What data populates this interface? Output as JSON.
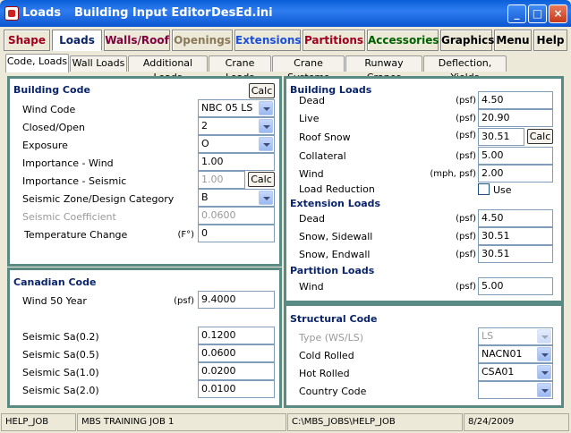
{
  "window": {
    "title_app": "Loads",
    "title_editor": "Building Input Editor",
    "title_file": "DesEd.ini"
  },
  "menu": [
    {
      "label": "Shape",
      "color": "#a0001e"
    },
    {
      "label": "Loads",
      "color": "#0a246a"
    },
    {
      "label": "Walls/Roof",
      "color": "#800040"
    },
    {
      "label": "Openings",
      "color": "#8a7a5a"
    },
    {
      "label": "Extensions",
      "color": "#1a4fd8"
    },
    {
      "label": "Partitions",
      "color": "#a0001e"
    },
    {
      "label": "Accessories",
      "color": "#006000"
    },
    {
      "label": "Graphics",
      "color": "#000000"
    },
    {
      "label": "Menu",
      "color": "#000000"
    },
    {
      "label": "Help",
      "color": "#000000"
    }
  ],
  "tabs": [
    "Code, Loads",
    "Wall Loads",
    "Additional Loads",
    "Crane Loads",
    "Crane Systems",
    "Runway Cranes",
    "Deflection, Yields"
  ],
  "building_code": {
    "title": "Building Code",
    "calc": "Calc",
    "wind_code": {
      "label": "Wind Code",
      "value": "NBC  05 LS"
    },
    "closed_open": {
      "label": "Closed/Open",
      "value": "2"
    },
    "exposure": {
      "label": "Exposure",
      "value": "O"
    },
    "imp_wind": {
      "label": "Importance - Wind",
      "value": "1.00"
    },
    "imp_seismic": {
      "label": "Importance - Seismic",
      "value": "1.00",
      "calc": "Calc"
    },
    "seismic_zone": {
      "label": "Seismic Zone/Design Category",
      "value": "B"
    },
    "seismic_coef": {
      "label": "Seismic Coefficient",
      "value": "0.0600"
    },
    "temp_change": {
      "label": "Temperature Change",
      "unit": "(F°)",
      "value": "0"
    }
  },
  "canadian_code": {
    "title": "Canadian Code",
    "wind50": {
      "label": "Wind 50 Year",
      "unit": "(psf)",
      "value": "9.4000"
    },
    "sa02": {
      "label": "Seismic Sa(0.2)",
      "value": "0.1200"
    },
    "sa05": {
      "label": "Seismic Sa(0.5)",
      "value": "0.0600"
    },
    "sa10": {
      "label": "Seismic Sa(1.0)",
      "value": "0.0200"
    },
    "sa20": {
      "label": "Seismic Sa(2.0)",
      "value": "0.0100"
    }
  },
  "building_loads": {
    "title": "Building Loads",
    "dead": {
      "label": "Dead",
      "unit": "(psf)",
      "value": "4.50"
    },
    "live": {
      "label": "Live",
      "unit": "(psf)",
      "value": "20.90"
    },
    "roof_snow": {
      "label": "Roof Snow",
      "unit": "(psf)",
      "value": "30.51",
      "calc": "Calc"
    },
    "collateral": {
      "label": "Collateral",
      "unit": "(psf)",
      "value": "5.00"
    },
    "wind": {
      "label": "Wind",
      "unit": "(mph, psf)",
      "value": "2.00"
    },
    "load_reduction": {
      "label": "Load Reduction",
      "check_label": "Use"
    }
  },
  "extension_loads": {
    "title": "Extension Loads",
    "dead": {
      "label": "Dead",
      "unit": "(psf)",
      "value": "4.50"
    },
    "snow_side": {
      "label": "Snow, Sidewall",
      "unit": "(psf)",
      "value": "30.51"
    },
    "snow_end": {
      "label": "Snow, Endwall",
      "unit": "(psf)",
      "value": "30.51"
    }
  },
  "partition_loads": {
    "title": "Partition Loads",
    "wind": {
      "label": "Wind",
      "unit": "(psf)",
      "value": "5.00"
    }
  },
  "structural_code": {
    "title": "Structural Code",
    "type": {
      "label": "Type (WS/LS)",
      "value": "LS"
    },
    "cold": {
      "label": "Cold Rolled",
      "value": "NACN01"
    },
    "hot": {
      "label": "Hot Rolled",
      "value": "CSA01"
    },
    "country": {
      "label": "Country Code",
      "value": ""
    }
  },
  "status": [
    "HELP_JOB",
    "MBS TRAINING JOB 1",
    "C:\\MBS_JOBS\\HELP_JOB",
    "8/24/2009"
  ]
}
